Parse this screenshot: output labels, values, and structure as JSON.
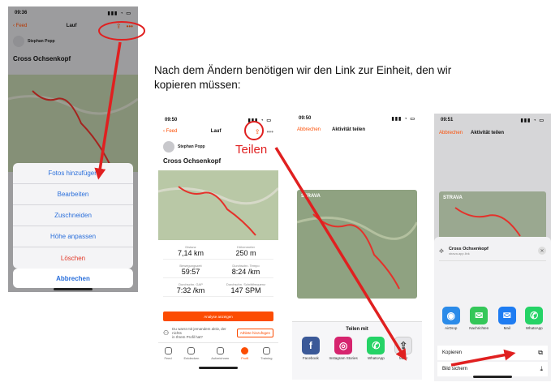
{
  "instruction": {
    "line1": "Nach dem Ändern benötigen wir den Link zur Einheit, den wir",
    "line2": "kopieren müssen:"
  },
  "annotation": {
    "share_label": "Teilen"
  },
  "phone1": {
    "time": "09:36",
    "nav": {
      "back": "Feed",
      "title": "Lauf"
    },
    "athlete": "Stephan Popp",
    "activity_title": "Cross Ochsenkopf",
    "action_sheet": [
      "Fotos hinzufügen",
      "Bearbeiten",
      "Zuschneiden",
      "Höhe anpassen",
      "Löschen"
    ],
    "cancel": "Abbrechen"
  },
  "phone2": {
    "time": "09:50",
    "nav": {
      "back": "Feed",
      "title": "Lauf"
    },
    "athlete": "Stephan Popp",
    "activity_title": "Cross Ochsenkopf",
    "stats": [
      {
        "label": "Distanz",
        "value": "7,14 km"
      },
      {
        "label": "Höhenmeter",
        "value": "250 m"
      },
      {
        "label": "Bewegungszeit",
        "value": "59:57"
      },
      {
        "label": "Durchschn. Tempo",
        "value": "8:24 /km"
      },
      {
        "label": "Durchschn. GAP",
        "value": "7:32 /km"
      },
      {
        "label": "Durchschn. Schrittfrequenz",
        "value": "147 SPM"
      }
    ],
    "analysis_button": "Analyse anzeigen",
    "invite_text": "Du warst mit jemandem aktiv, der nichts",
    "invite_text2": "in Ihrem Profil hat?",
    "invite_button": "Athlete hinzufügen",
    "tabs": [
      "Feed",
      "Entdecken",
      "Aufzeichnen",
      "Profil",
      "Training"
    ]
  },
  "phone3": {
    "time": "09:50",
    "nav": {
      "cancel": "Abbrechen",
      "title": "Aktivität teilen"
    },
    "map_brand": "STRAVA",
    "share_title": "Teilen mit",
    "apps": [
      {
        "name": "Facebook",
        "glyph": "f",
        "color": "#3b5998"
      },
      {
        "name": "Instagram Stories",
        "glyph": "◎",
        "color": "#d6246e"
      },
      {
        "name": "WhatsApp",
        "glyph": "✆",
        "color": "#25d366"
      },
      {
        "name": "Mehr",
        "glyph": "⇪",
        "color": "#e6e6e9"
      }
    ]
  },
  "phone4": {
    "time": "09:51",
    "nav": {
      "cancel": "Abbrechen",
      "title": "Aktivität teilen"
    },
    "map_brand": "STRAVA",
    "sheet_title": "Cross Ochsenkopf",
    "sheet_sub": "strava.app.link",
    "apps": [
      {
        "name": "AirDrop",
        "glyph": "◉",
        "color": "#2b8be9"
      },
      {
        "name": "Nachrichten",
        "glyph": "✉",
        "color": "#34c759"
      },
      {
        "name": "Mail",
        "glyph": "✉",
        "color": "#1e7cf2"
      },
      {
        "name": "WhatsApp",
        "glyph": "✆",
        "color": "#25d366"
      }
    ],
    "actions": [
      "Kopieren",
      "Bild sichern"
    ]
  }
}
